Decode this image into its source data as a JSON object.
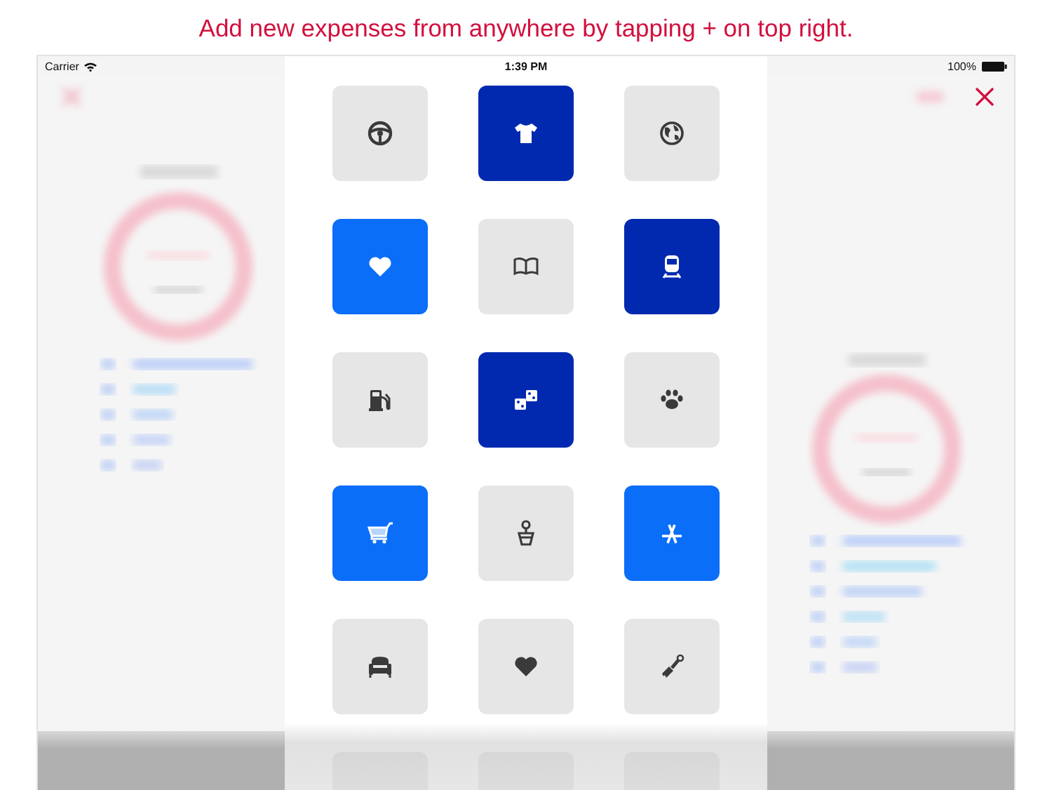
{
  "caption": "Add new expenses from anywhere by tapping + on top right.",
  "status_bar": {
    "carrier": "Carrier",
    "time": "1:39 PM",
    "battery": "100%"
  },
  "tiles": [
    {
      "color": "#e6e6e6"
    },
    {
      "color": "#0029b0"
    },
    {
      "color": "#e6e6e6"
    },
    {
      "color": "#0a6ef9"
    },
    {
      "color": "#e6e6e6"
    },
    {
      "color": "#0029b0"
    },
    {
      "color": "#e6e6e6"
    },
    {
      "color": "#0029b0"
    },
    {
      "color": "#e6e6e6"
    },
    {
      "color": "#0a6ef9"
    },
    {
      "color": "#e6e6e6"
    },
    {
      "color": "#0a6ef9"
    },
    {
      "color": "#e6e6e6"
    },
    {
      "color": "#e6e6e6"
    },
    {
      "color": "#e6e6e6"
    },
    {
      "color": "#e6e6e6"
    },
    {
      "color": "#e6e6e6"
    },
    {
      "color": "#e6e6e6"
    }
  ]
}
